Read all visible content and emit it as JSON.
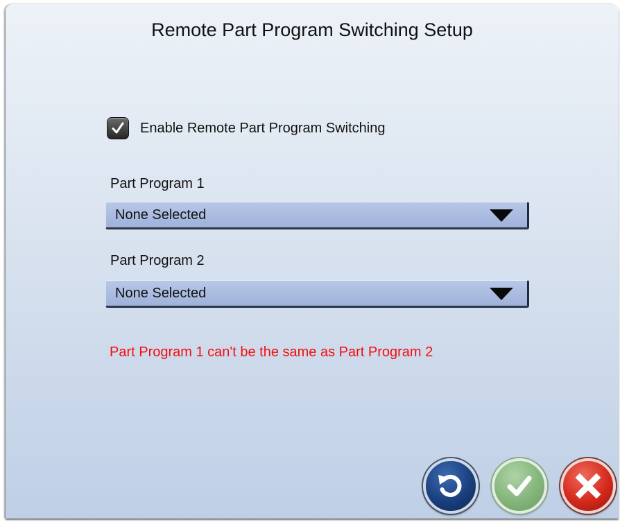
{
  "dialog": {
    "title": "Remote Part Program Switching Setup"
  },
  "enable_checkbox": {
    "label": "Enable Remote Part Program Switching",
    "checked": true
  },
  "part_program_1": {
    "label": "Part Program 1",
    "selected": "None Selected"
  },
  "part_program_2": {
    "label": "Part Program 2",
    "selected": "None Selected"
  },
  "error": {
    "message": "Part Program 1 can't be the same as Part Program 2",
    "color": "#f20f0f"
  },
  "buttons": {
    "undo": {
      "icon": "undo-icon"
    },
    "ok": {
      "icon": "checkmark-icon"
    },
    "cancel": {
      "icon": "close-icon"
    }
  }
}
